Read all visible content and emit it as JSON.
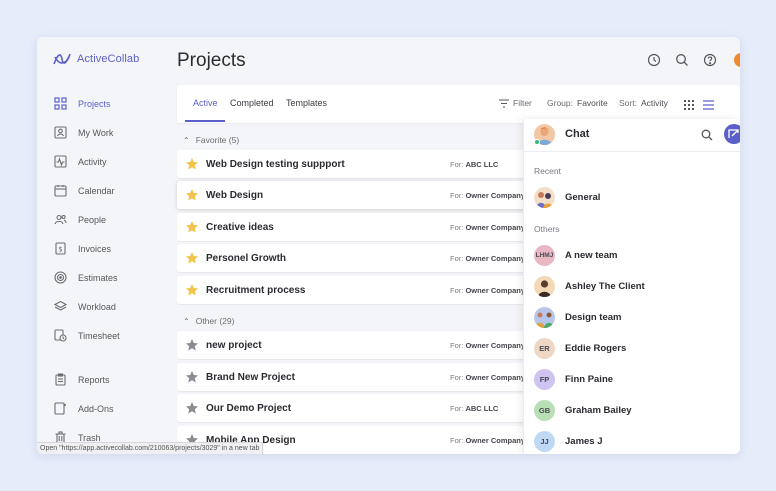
{
  "app": {
    "logo_text": "ActiveCollab"
  },
  "sidebar": {
    "items": [
      {
        "label": "Projects",
        "icon": "grid-icon",
        "active": true
      },
      {
        "label": "My Work",
        "icon": "user-card-icon"
      },
      {
        "label": "Activity",
        "icon": "activity-icon"
      },
      {
        "label": "Calendar",
        "icon": "calendar-icon"
      },
      {
        "label": "People",
        "icon": "people-icon"
      },
      {
        "label": "Invoices",
        "icon": "invoice-icon"
      },
      {
        "label": "Estimates",
        "icon": "target-icon"
      },
      {
        "label": "Workload",
        "icon": "layers-icon"
      },
      {
        "label": "Timesheet",
        "icon": "timesheet-icon"
      },
      {
        "label": "Reports",
        "icon": "clipboard-icon"
      },
      {
        "label": "Add-Ons",
        "icon": "addon-icon"
      },
      {
        "label": "Trash",
        "icon": "trash-icon"
      }
    ]
  },
  "header": {
    "title": "Projects"
  },
  "tabs": [
    "Active",
    "Completed",
    "Templates"
  ],
  "toolbar": {
    "filter_label": "Filter",
    "group_label": "Group:",
    "group_value": "Favorite",
    "sort_label": "Sort:",
    "sort_value": "Activity"
  },
  "groups": {
    "favorite": "Favorite (5)",
    "other": "Other (29)"
  },
  "projects": {
    "favorite": [
      {
        "name": "Web Design testing suppport",
        "for": "ABC LLC"
      },
      {
        "name": "Web Design",
        "for": "Owner Company"
      },
      {
        "name": "Creative ideas",
        "for": "Owner Company"
      },
      {
        "name": "Personel Growth",
        "for": "Owner Company"
      },
      {
        "name": "Recruitment process",
        "for": "Owner Company"
      }
    ],
    "other": [
      {
        "name": "new project",
        "for": "Owner Company"
      },
      {
        "name": "Brand New Project",
        "for": "Owner Company"
      },
      {
        "name": "Our Demo Project",
        "for": "ABC LLC"
      },
      {
        "name": "Mobile App Design",
        "for": "Owner Company"
      }
    ],
    "for_prefix": "For:"
  },
  "chat": {
    "title": "Chat",
    "recent_label": "Recent",
    "others_label": "Others",
    "recent": [
      {
        "name": "General"
      }
    ],
    "others": [
      {
        "name": "A new team",
        "initials": "LHMJ",
        "color": "#e8b7c4"
      },
      {
        "name": "Ashley The Client",
        "initials": "",
        "color": "#f3d9b8"
      },
      {
        "name": "Design team",
        "initials": "",
        "color": "#b9c6ea"
      },
      {
        "name": "Eddie Rogers",
        "initials": "ER",
        "color": "#efd7c6"
      },
      {
        "name": "Finn Paine",
        "initials": "FP",
        "color": "#cfc3f2"
      },
      {
        "name": "Graham Bailey",
        "initials": "GB",
        "color": "#b9dfb6"
      },
      {
        "name": "James J",
        "initials": "JJ",
        "color": "#bfd9f5"
      }
    ]
  },
  "status_bar": "Open \"https://app.activecollab.com/210063/projects/3029\" in a new tab",
  "colors": {
    "accent": "#5b5fc7",
    "star_favorite": "#f3c24a",
    "star_other": "#8a8c93"
  }
}
